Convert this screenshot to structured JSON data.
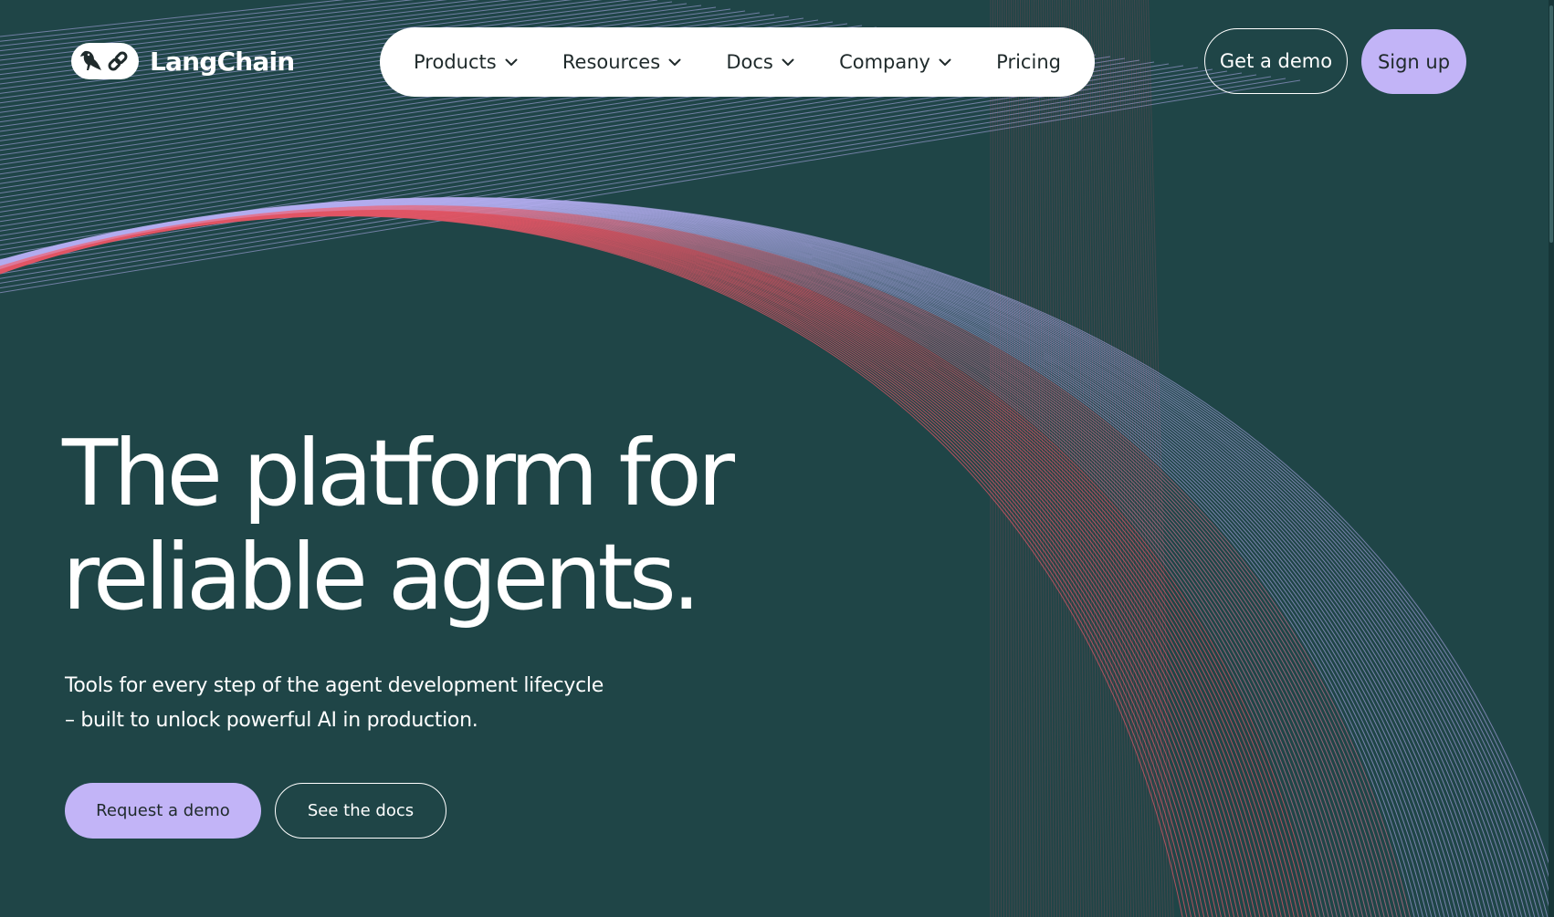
{
  "brand": {
    "name": "LangChain",
    "logo_icon": "parrot-link-icon"
  },
  "nav": {
    "items": [
      {
        "label": "Products",
        "icon": "chevron-down-icon"
      },
      {
        "label": "Resources",
        "icon": "chevron-down-icon"
      },
      {
        "label": "Docs",
        "icon": "chevron-down-icon"
      },
      {
        "label": "Company",
        "icon": "chevron-down-icon"
      },
      {
        "label": "Pricing"
      }
    ]
  },
  "header_actions": {
    "get_demo": "Get a demo",
    "sign_up": "Sign up"
  },
  "hero": {
    "title_line1": "The platform for",
    "title_line2": "reliable agents.",
    "subtitle_line1": "Tools for every step of the agent development lifecycle",
    "subtitle_line2": "– built to unlock powerful AI in production.",
    "primary_cta": "Request a demo",
    "secondary_cta": "See the docs"
  },
  "colors": {
    "background": "#1f4547",
    "accent": "#c2b4f7",
    "line_lavender": "#b4aef0",
    "line_pink": "#e07a9a",
    "line_red": "#e25565",
    "text": "#ffffff"
  }
}
